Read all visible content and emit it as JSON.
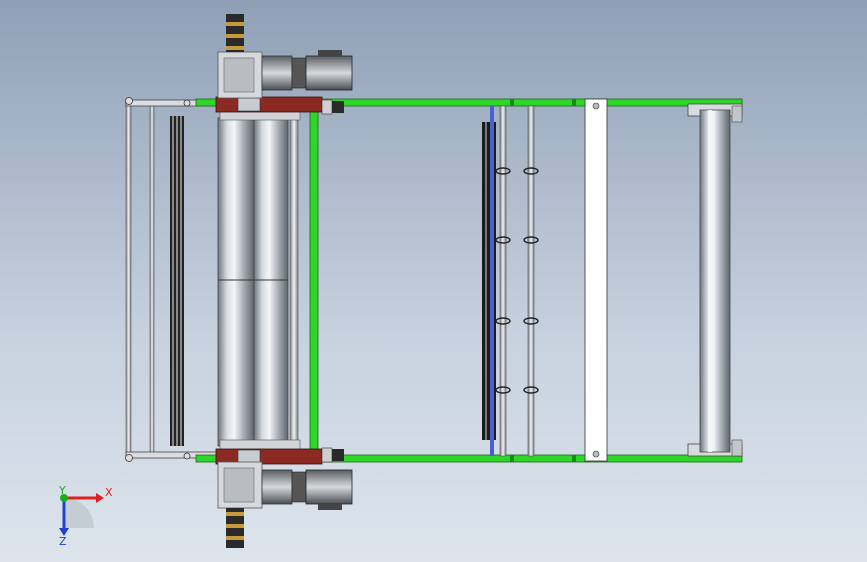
{
  "viewport": {
    "background_top": "#8fa0b6",
    "background_bottom": "#dde4ec"
  },
  "colors": {
    "frame_green": "#2fd62a",
    "frame_green_dark": "#1a8a16",
    "bracket_red": "#8b2a22",
    "roller_light": "#e6eaee",
    "roller_dark": "#7e868e",
    "motor_dark": "#3a3a3a",
    "motor_light": "#c9cdd2",
    "axis_x": "#e02020",
    "axis_y": "#18b018",
    "axis_z": "#2040d0"
  },
  "triad": {
    "x_label": "X",
    "y_label": "Y",
    "z_label": "Z"
  }
}
